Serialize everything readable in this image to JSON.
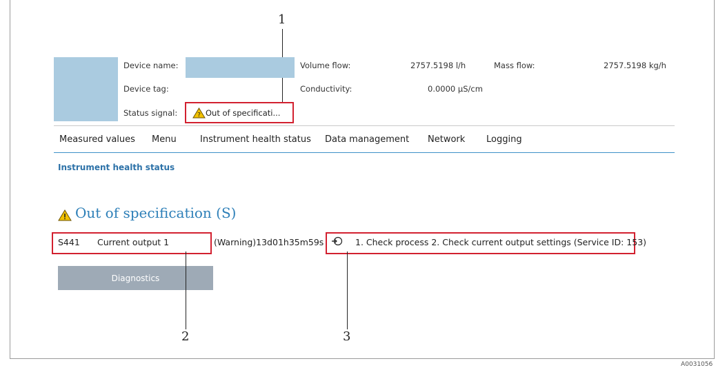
{
  "header": {
    "device_name_label": "Device name:",
    "device_tag_label": "Device tag:",
    "status_signal_label": "Status signal:",
    "status_signal_value": "Out of specificati...",
    "volume_flow_label": "Volume flow:",
    "volume_flow_value": "2757.5198 l/h",
    "mass_flow_label": "Mass flow:",
    "mass_flow_value": "2757.5198 kg/h",
    "conductivity_label": "Conductivity:",
    "conductivity_value": "0.0000 µS/cm"
  },
  "nav": {
    "items": [
      "Measured values",
      "Menu",
      "Instrument health status",
      "Data management",
      "Network",
      "Logging"
    ]
  },
  "breadcrumb": "Instrument health status",
  "status": {
    "title": "Out of specification (S)",
    "code": "S441",
    "channel": "Current output 1",
    "warning_time": "(Warning)13d01h35m59s",
    "remedy": "1. Check process 2. Check current output settings (Service ID: 153)",
    "warning_icon": "warning-triangle-icon",
    "remedy_icon": "service-plug-icon"
  },
  "diagnostics_button": "Diagnostics",
  "callouts": [
    "1",
    "2",
    "3"
  ],
  "figure_id": "A0031056",
  "colors": {
    "accent": "#2d7fb8",
    "highlight": "#d2202f",
    "placeholder": "#aacbe0",
    "button": "#9eaab6",
    "warning": "#f2c200"
  }
}
